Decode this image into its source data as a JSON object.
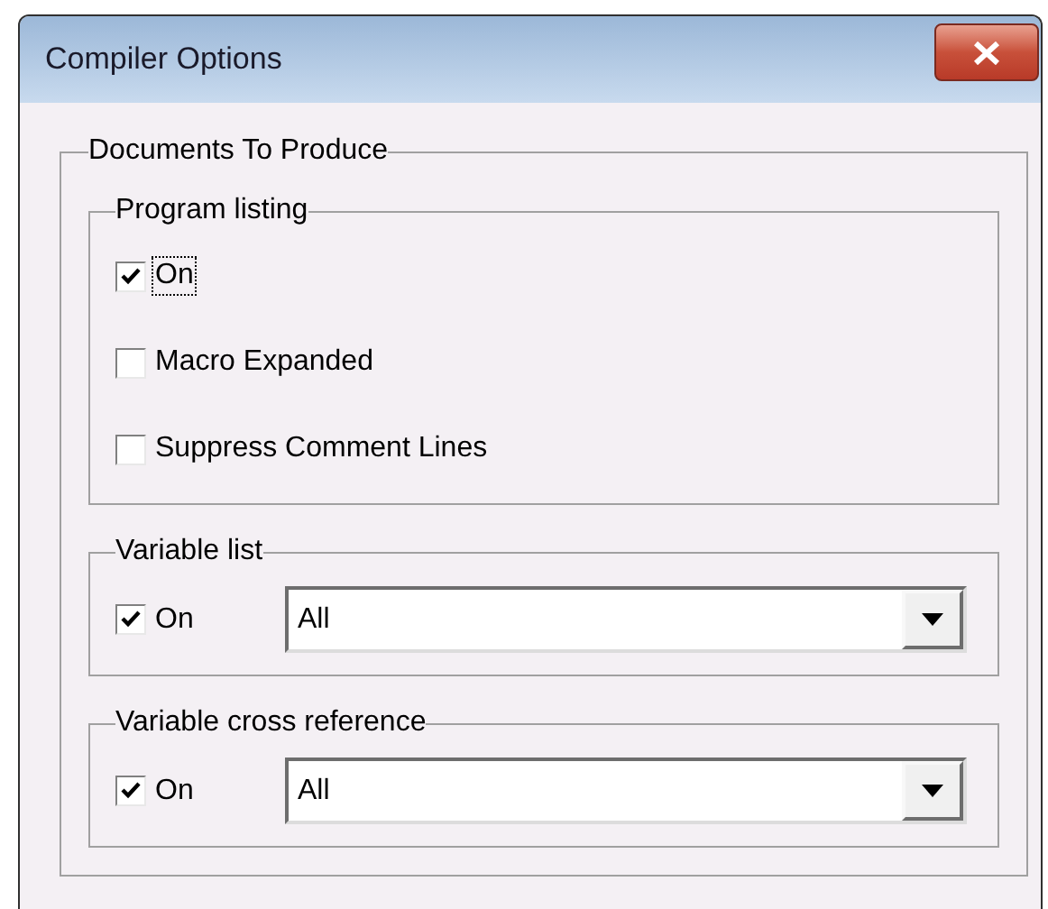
{
  "window": {
    "title": "Compiler Options"
  },
  "documents_group": {
    "title": "Documents To Produce",
    "program_listing": {
      "title": "Program listing",
      "options": [
        {
          "label": "On",
          "checked": true,
          "focused": true
        },
        {
          "label": "Macro Expanded",
          "checked": false,
          "focused": false
        },
        {
          "label": "Suppress Comment Lines",
          "checked": false,
          "focused": false
        }
      ]
    },
    "sub_groups": [
      {
        "title": "Variable list",
        "toggle": {
          "label": "On",
          "checked": true
        },
        "dropdown": {
          "value": "All"
        }
      },
      {
        "title": "Variable cross reference",
        "toggle": {
          "label": "On",
          "checked": true
        },
        "dropdown": {
          "value": "All"
        }
      }
    ]
  }
}
